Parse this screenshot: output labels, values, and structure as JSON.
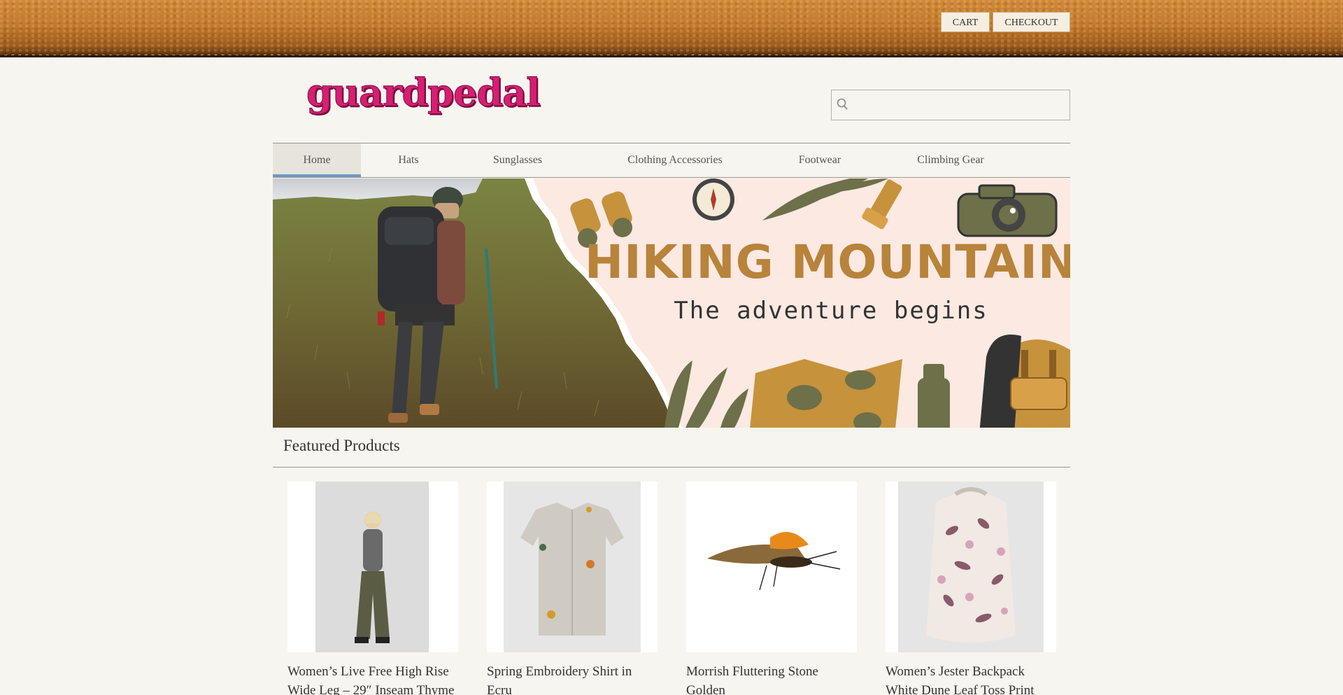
{
  "header": {
    "cart_label": "CART",
    "checkout_label": "CHECKOUT"
  },
  "logo": {
    "text": "guardpedal"
  },
  "search": {
    "placeholder": "",
    "value": ""
  },
  "nav": {
    "items": [
      {
        "label": "Home",
        "active": true
      },
      {
        "label": "Hats",
        "active": false
      },
      {
        "label": "Sunglasses",
        "active": false
      },
      {
        "label": "Clothing Accessories",
        "active": false
      },
      {
        "label": "Footwear",
        "active": false
      },
      {
        "label": "Climbing Gear",
        "active": false
      }
    ]
  },
  "hero": {
    "headline": "HIKING MOUNTAIN",
    "tagline": "The adventure begins"
  },
  "featured": {
    "title": "Featured Products",
    "products": [
      {
        "name": "Women’s Live Free High Rise Wide Leg – 29″ Inseam Thyme"
      },
      {
        "name": "Spring Embroidery Shirt in Ecru"
      },
      {
        "name": "Morrish Fluttering Stone Golden"
      },
      {
        "name": "Women’s Jester Backpack White Dune Leaf Toss Print"
      }
    ]
  },
  "colors": {
    "brand_pink": "#d51f73",
    "hero_title": "#b8833a",
    "nav_active_underline": "#6d9ac4"
  }
}
